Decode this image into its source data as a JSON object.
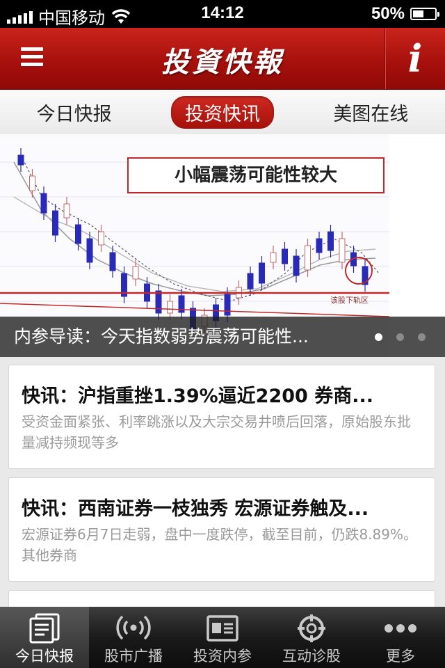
{
  "status_bar": {
    "carrier": "中国移动",
    "time": "14:12",
    "battery": "50%",
    "battery_level": 0.5
  },
  "header": {
    "title": "投資快報",
    "info_label": "i"
  },
  "tabs": [
    {
      "label": "今日快报",
      "active": false
    },
    {
      "label": "投资快讯",
      "active": true
    },
    {
      "label": "美图在线",
      "active": false
    }
  ],
  "banner": {
    "chart_box_text": "小幅震荡可能性较大",
    "chart_small_text": "该股下轨区",
    "caption": "内参导读：今天指数弱势震荡可能性...",
    "page_count": 3,
    "current_page": 1
  },
  "news": [
    {
      "title": "快讯：沪指重挫1.39%逼近2200 券商...",
      "summary": "受资金面紧张、利率跳涨以及大宗交易井喷后回落，原始股东批量减持频现等多"
    },
    {
      "title": "快讯：西南证券一枝独秀 宏源证券触及...",
      "summary": "宏源证券6月7日走弱，盘中一度跌停，截至目前，仍跌8.89%。其他券商"
    }
  ],
  "tabbar": [
    {
      "label": "今日快报",
      "icon": "news-doc-icon",
      "active": true
    },
    {
      "label": "股市广播",
      "icon": "broadcast-icon",
      "active": false
    },
    {
      "label": "投资内参",
      "icon": "report-icon",
      "active": false
    },
    {
      "label": "互动诊股",
      "icon": "crosshair-icon",
      "active": false
    },
    {
      "label": "更多",
      "icon": "more-dots-icon",
      "active": false
    }
  ]
}
